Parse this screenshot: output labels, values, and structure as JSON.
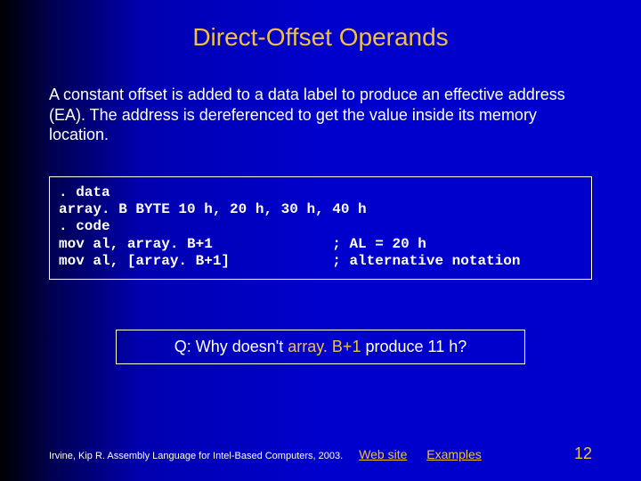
{
  "title": "Direct-Offset Operands",
  "body": "A constant offset is added to a data label to produce an effective address (EA). The address is dereferenced to get the value inside its memory location.",
  "code": {
    "line1": ". data",
    "line2": "array. B BYTE 10 h, 20 h, 30 h, 40 h",
    "line3": ". code",
    "line4_left": "mov al, array. B+1",
    "line4_right": "; AL = 20 h",
    "line5_left": "mov al, [array. B+1]",
    "line5_right": "; alternative notation"
  },
  "question": {
    "prefix": "Q: Why doesn't ",
    "expr": "array. B+1",
    "suffix": " produce 11 h?"
  },
  "footer": {
    "credit": "Irvine, Kip R. Assembly Language for Intel-Based Computers, 2003.",
    "link1": "Web site",
    "link2": "Examples",
    "page": "12"
  }
}
